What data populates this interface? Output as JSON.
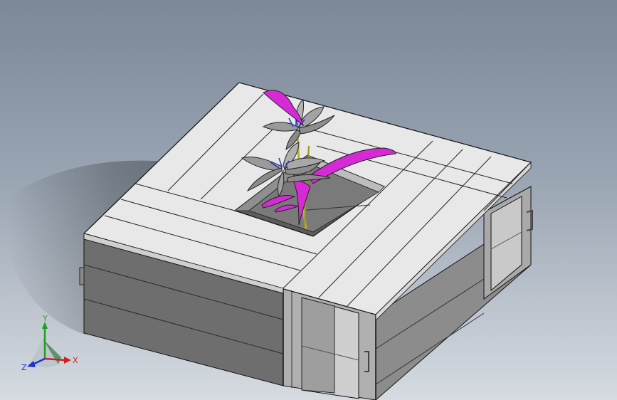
{
  "viewport": {
    "background_top": "#7c8797",
    "background_bottom": "#d6dbe1"
  },
  "model": {
    "wood_top": "#e8e8e8",
    "wood_side_left": "#6e6e6e",
    "wood_side_right": "#8c8c8c",
    "edge": "#111111",
    "leaf_accent": "#d62ad6",
    "leaf_gray": "#9a9a9a",
    "stem": "#b8b230"
  },
  "triad": {
    "x_label": "X",
    "y_label": "Y",
    "z_label": "Z",
    "x_color": "#d22020",
    "y_color": "#20a020",
    "z_color": "#2030d0",
    "x_icon": "axis-x-arrow",
    "y_icon": "axis-y-arrow",
    "z_icon": "axis-z-arrow"
  }
}
